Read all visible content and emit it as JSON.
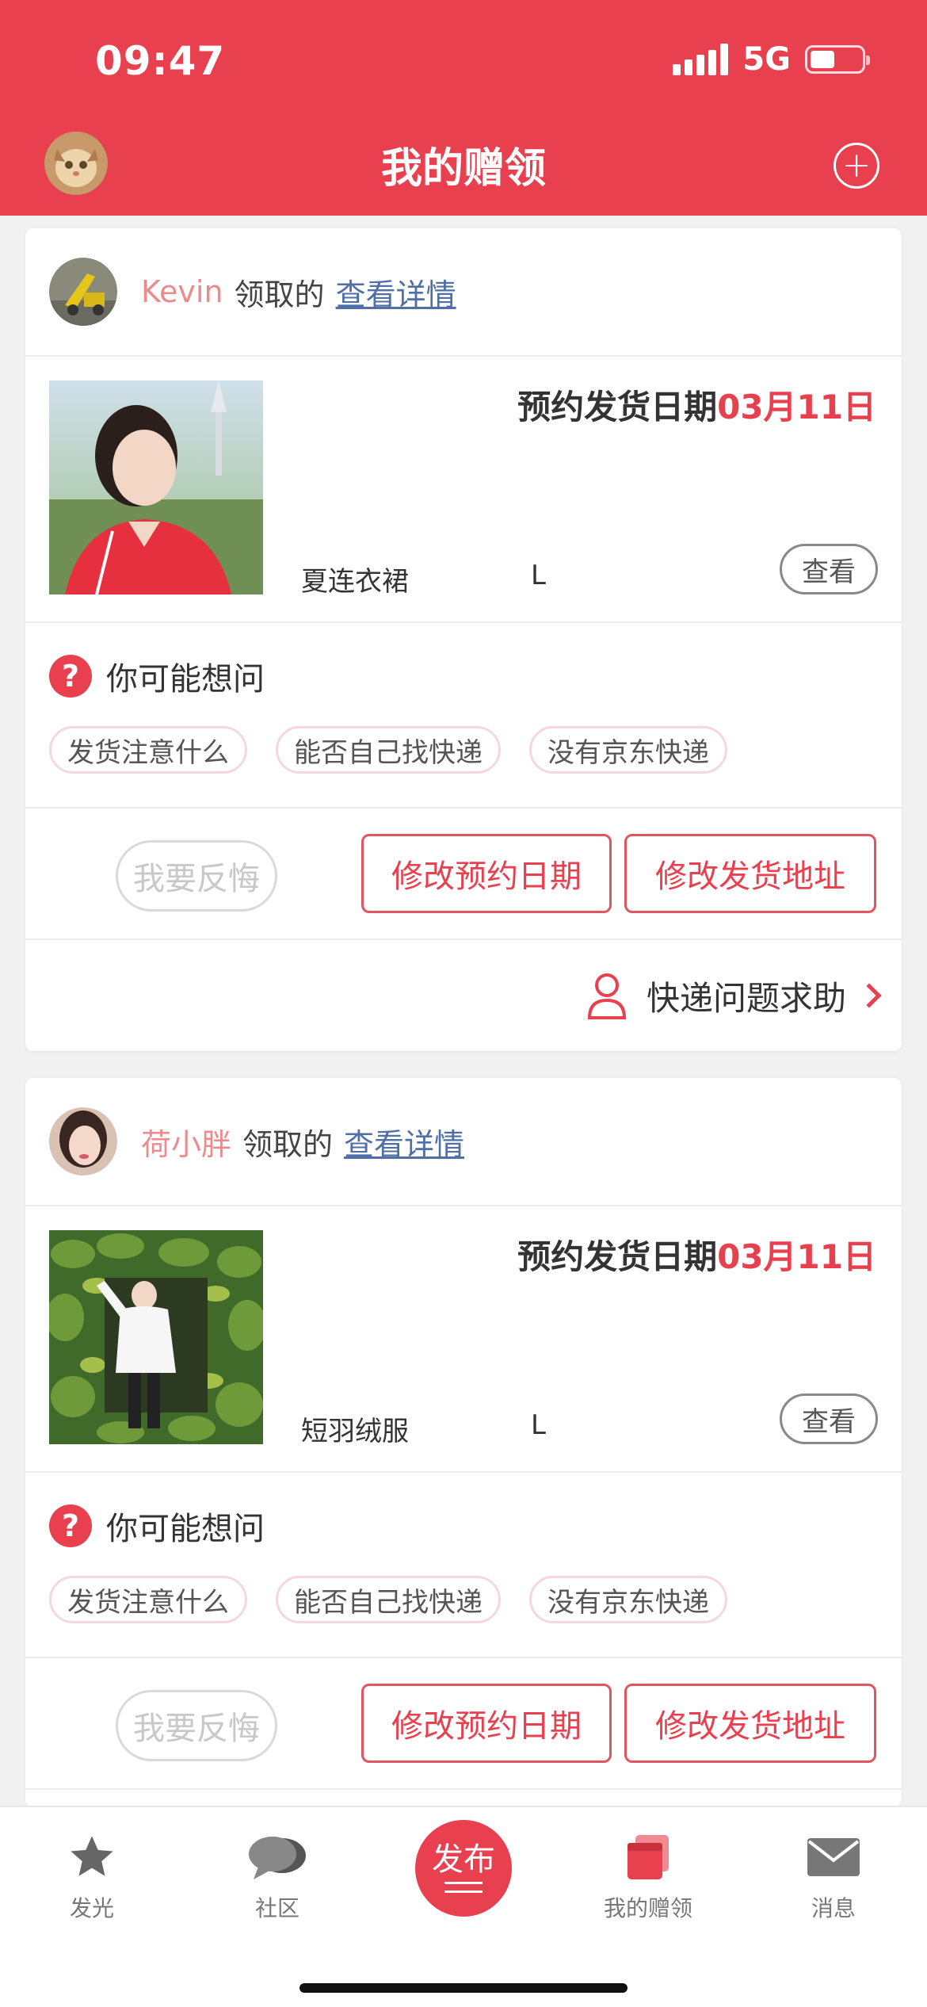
{
  "status_bar": {
    "time": "09:47",
    "network": "5G"
  },
  "header": {
    "title": "我的赠领",
    "add_icon": "plus-circle-icon"
  },
  "cards": [
    {
      "user": "Kevin",
      "claim_text": "领取的",
      "detail_link": "查看详情",
      "ship_label": "预约发货日期",
      "ship_date": "03月11日",
      "product_name": "夏连衣裙",
      "size": "L",
      "view_label": "查看",
      "faq_title": "你可能想问",
      "faq_chips": [
        "发货注意什么",
        "能否自己找快递",
        "没有京东快递"
      ],
      "regret_label": "我要反悔",
      "change_date_label": "修改预约日期",
      "change_address_label": "修改发货地址",
      "help_label": "快递问题求助"
    },
    {
      "user": "荷小胖",
      "claim_text": "领取的",
      "detail_link": "查看详情",
      "ship_label": "预约发货日期",
      "ship_date": "03月11日",
      "product_name": "短羽绒服",
      "size": "L",
      "view_label": "查看",
      "faq_title": "你可能想问",
      "faq_chips": [
        "发货注意什么",
        "能否自己找快递",
        "没有京东快递"
      ],
      "regret_label": "我要反悔",
      "change_date_label": "修改预约日期",
      "change_address_label": "修改发货地址"
    }
  ],
  "tabbar": {
    "items": [
      {
        "label": "发光",
        "icon": "star-icon"
      },
      {
        "label": "社区",
        "icon": "chat-bubbles-icon"
      },
      {
        "label": "发布",
        "icon": "publish-icon"
      },
      {
        "label": "我的赠领",
        "icon": "cards-icon",
        "active": true
      },
      {
        "label": "消息",
        "icon": "mail-icon"
      }
    ]
  },
  "colors": {
    "brand": "#e8404f",
    "link": "#4f6fa5",
    "username": "#ec8b8e"
  }
}
